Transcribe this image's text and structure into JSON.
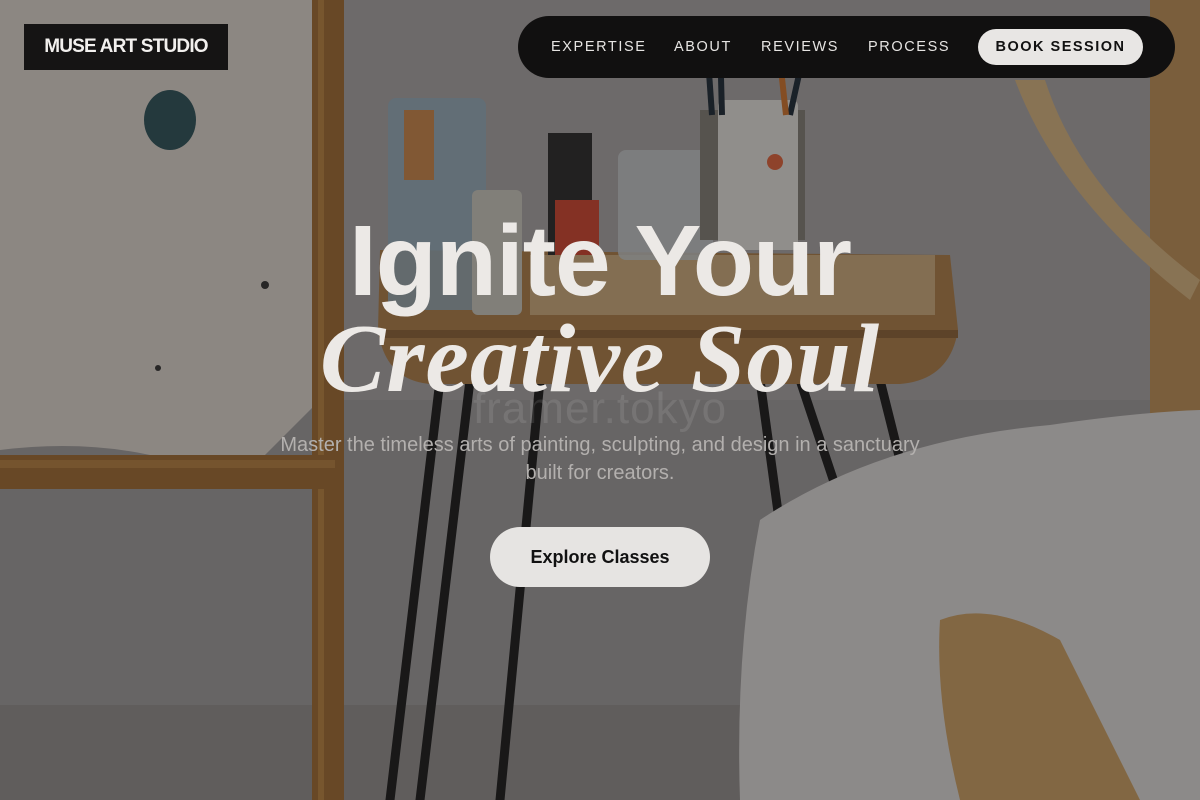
{
  "brand": {
    "logo_text": "MUSE ART STUDIO"
  },
  "nav": {
    "links": [
      {
        "label": "EXPERTISE"
      },
      {
        "label": "ABOUT"
      },
      {
        "label": "REVIEWS"
      },
      {
        "label": "PROCESS"
      }
    ],
    "cta_label": "BOOK SESSION"
  },
  "hero": {
    "title_line1": "Ignite Your",
    "title_line2": "Creative Soul",
    "subtitle": "Master the timeless arts of painting, sculpting, and design in a sanctuary built for creators.",
    "cta_label": "Explore Classes",
    "watermark": "framer.tokyo",
    "background_image": "art-studio-photo"
  },
  "colors": {
    "nav_background": "#111010",
    "button_background": "#e6e4e2",
    "heading_text": "#ece9e6",
    "subtitle_text": "#b3b0ae"
  }
}
